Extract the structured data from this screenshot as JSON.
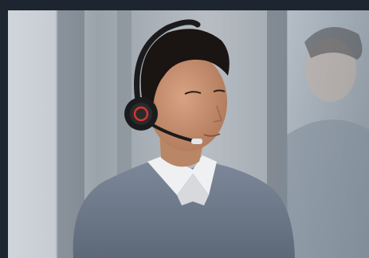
{
  "photo": {
    "subject": "person-wearing-headset",
    "colors": {
      "frame": "#1c2530",
      "background": "#a9b0b7",
      "sweater": "#6f7b8c",
      "skin": "#c99270",
      "hair": "#1a1412",
      "headset": "#1b1b1d",
      "headset_accent": "#d8362b"
    }
  }
}
